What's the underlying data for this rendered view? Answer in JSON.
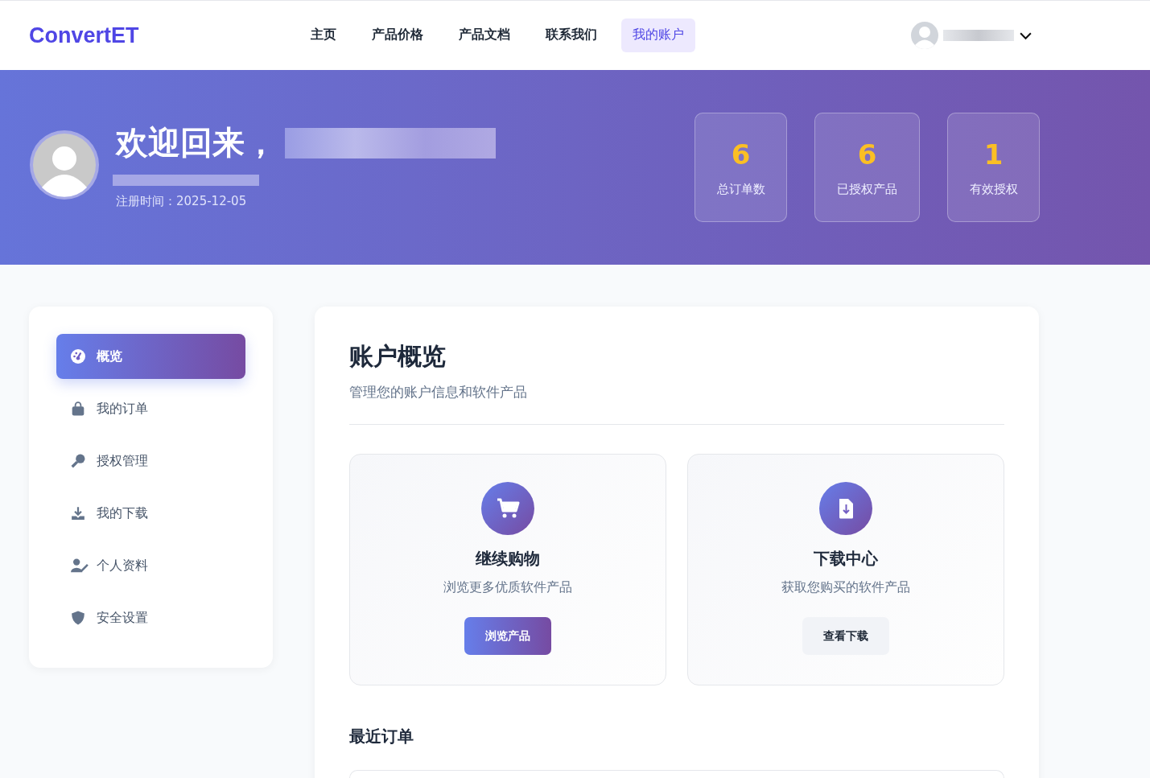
{
  "nav": {
    "logo": "ConvertET",
    "links": [
      {
        "label": "主页",
        "selected": false
      },
      {
        "label": "产品价格",
        "selected": false
      },
      {
        "label": "产品文档",
        "selected": false
      },
      {
        "label": "联系我们",
        "selected": false
      },
      {
        "label": "我的账户",
        "selected": true
      }
    ]
  },
  "hero": {
    "greeting": "欢迎回来，",
    "registered": "注册时间：2025-12-05",
    "stats": [
      {
        "value": "6",
        "label": "总订单数"
      },
      {
        "value": "6",
        "label": "已授权产品"
      },
      {
        "value": "1",
        "label": "有效授权"
      }
    ]
  },
  "sidebar": {
    "items": [
      {
        "label": "概览",
        "kind": "gauge",
        "selected": true
      },
      {
        "label": "我的订单",
        "kind": "bag",
        "selected": false
      },
      {
        "label": "授权管理",
        "kind": "key",
        "selected": false
      },
      {
        "label": "我的下载",
        "kind": "download",
        "selected": false
      },
      {
        "label": "个人资料",
        "kind": "profile",
        "selected": false
      },
      {
        "label": "安全设置",
        "kind": "shield",
        "selected": false
      }
    ]
  },
  "main": {
    "title": "账户概览",
    "subtitle": "管理您的账户信息和软件产品",
    "cards": [
      {
        "kind": "cart",
        "title": "继续购物",
        "text": "浏览更多优质软件产品",
        "button": {
          "label": "浏览产品",
          "kind": "primary"
        }
      },
      {
        "kind": "download",
        "title": "下载中心",
        "text": "获取您购买的软件产品",
        "button": {
          "label": "查看下载",
          "kind": "secondary"
        }
      }
    ],
    "recent_title": "最近订单"
  }
}
